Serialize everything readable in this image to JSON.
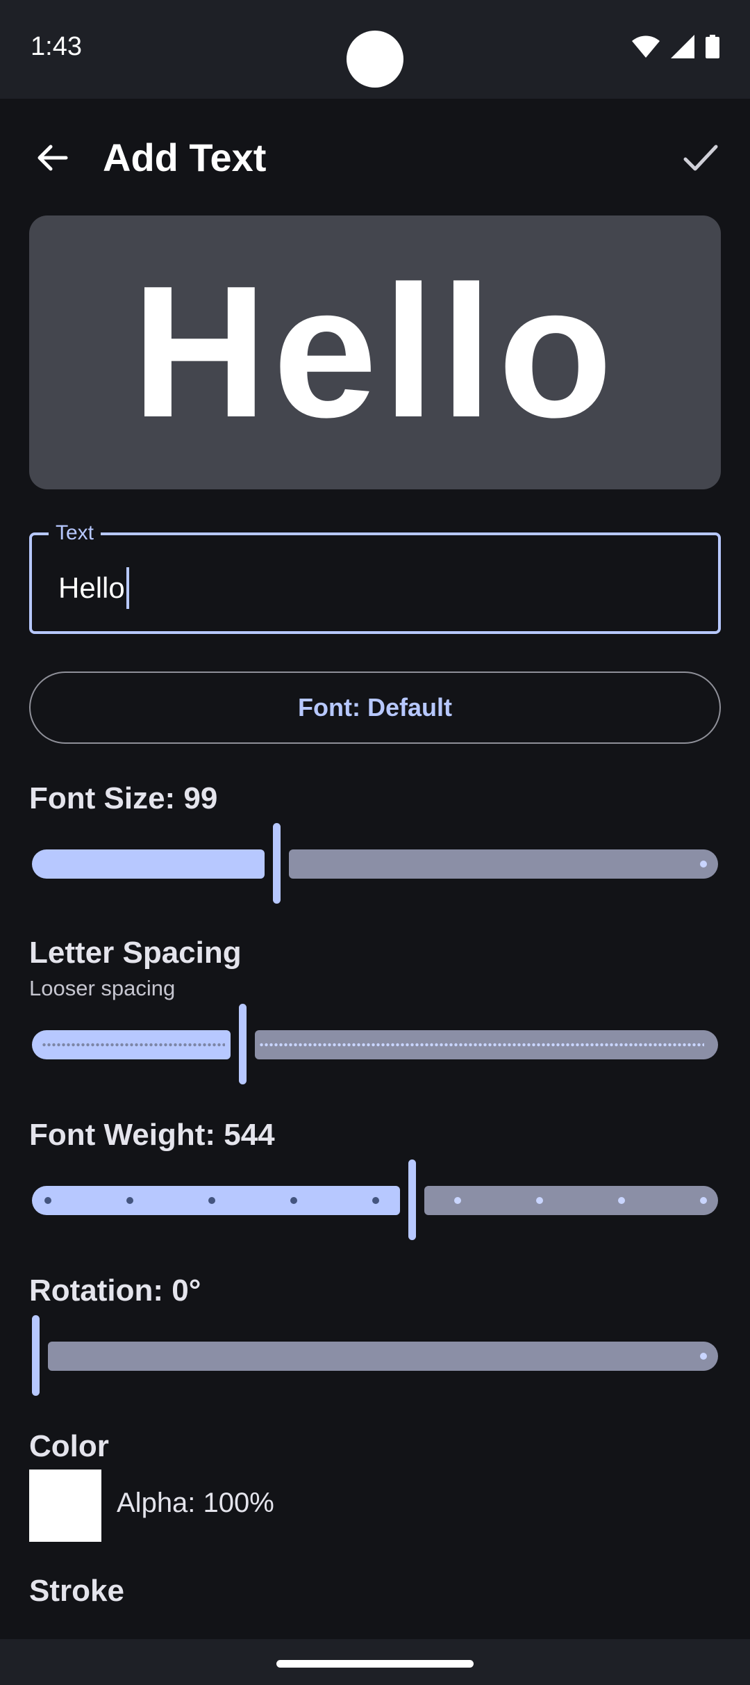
{
  "status_bar": {
    "time": "1:43"
  },
  "app_bar": {
    "title": "Add Text"
  },
  "preview": {
    "text": "Hello"
  },
  "text_field": {
    "label": "Text",
    "value": "Hello"
  },
  "font_button": {
    "label": "Font: Default"
  },
  "font_size": {
    "title": "Font Size: 99",
    "fraction": 0.355
  },
  "letter_spacing": {
    "title": "Letter Spacing",
    "subtitle": "Looser spacing",
    "fraction": 0.305
  },
  "font_weight": {
    "title": "Font Weight: 544",
    "fraction": 0.555
  },
  "rotation": {
    "title": "Rotation: 0°",
    "fraction": 0.0
  },
  "color": {
    "title": "Color",
    "swatch": "#ffffff",
    "alpha_label": "Alpha: 100%"
  },
  "stroke": {
    "title": "Stroke"
  },
  "colors": {
    "accent": "#b7c8ff",
    "track_inactive": "#8b8fa6",
    "background": "#121317"
  }
}
